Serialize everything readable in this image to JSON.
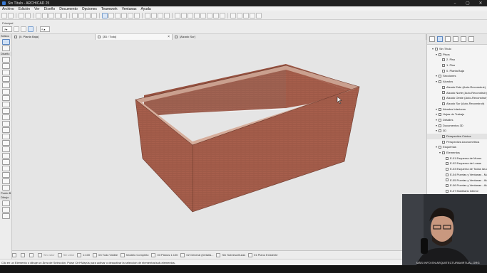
{
  "window": {
    "title": "Sin Título - ARCHICAD 25"
  },
  "menu": [
    "Archivo",
    "Edición",
    "Ver",
    "Diseño",
    "Documento",
    "Opciones",
    "Teamwork",
    "Ventanas",
    "Ayuda"
  ],
  "infobox": {
    "label": "Principal"
  },
  "toolbox": {
    "sections": [
      "Selecc",
      "Diseño",
      "Punto B",
      "Dibujo"
    ]
  },
  "tabs": [
    {
      "label": "[0. Planta Baja]",
      "active": false
    },
    {
      "label": "[3D / Todo]",
      "active": true
    },
    {
      "label": "[Alzado Sur]",
      "active": false
    }
  ],
  "navigator": {
    "items": [
      {
        "label": "Sin Título",
        "depth": 1
      },
      {
        "label": "Pisos",
        "depth": 2
      },
      {
        "label": "2. Piso",
        "depth": 3
      },
      {
        "label": "1. Piso",
        "depth": 3
      },
      {
        "label": "0. Planta Baja",
        "depth": 3
      },
      {
        "label": "Secciones",
        "depth": 2
      },
      {
        "label": "Alzados",
        "depth": 2
      },
      {
        "label": "Alzado Este (Auto-Reconstruir)",
        "depth": 3
      },
      {
        "label": "Alzado Norte (Auto-Reconstruir)",
        "depth": 3
      },
      {
        "label": "Alzado Oeste (Auto-Reconstruir)",
        "depth": 3
      },
      {
        "label": "Alzado Sur (Auto-Reconstruir)",
        "depth": 3
      },
      {
        "label": "Alzados Interiores",
        "depth": 2
      },
      {
        "label": "Hojas de Trabajo",
        "depth": 2
      },
      {
        "label": "Detalles",
        "depth": 2
      },
      {
        "label": "Documentos 3D",
        "depth": 2
      },
      {
        "label": "3D",
        "depth": 2
      },
      {
        "label": "Perspectiva Cónica",
        "depth": 3,
        "selected": true
      },
      {
        "label": "Perspectiva Axonométrica",
        "depth": 3
      },
      {
        "label": "Esquemas",
        "depth": 2
      },
      {
        "label": "Elementos",
        "depth": 3
      },
      {
        "label": "E-01 Esquema de Muros",
        "depth": 4
      },
      {
        "label": "E-02 Esquema de Losas",
        "depth": 4
      },
      {
        "label": "E-03 Esquema de Todas las Aberturas",
        "depth": 4
      },
      {
        "label": "E-04 Puertas y Ventanas - Mapa",
        "depth": 4
      },
      {
        "label": "E-05 Puertas y Ventanas - Alzados",
        "depth": 4
      },
      {
        "label": "E-06 Puertas y Ventanas - Alzados",
        "depth": 4
      },
      {
        "label": "E-07 Mobiliario interior",
        "depth": 4
      }
    ]
  },
  "statusbar": {
    "items": [
      "Sin valor",
      "Sin valor",
      "1:100",
      "03 Todo Visible",
      "Modelo Completo",
      "03 Planos 1:100",
      "02 General (Detalla...",
      "Sin Sobrescrituras",
      "01 Plano Existente"
    ]
  },
  "message": "Clic en un Elemento o dibuje un Área de Selección. Pulse Ctrl+Mayús para activar o desactivar la selección de elementos/sub-elementos.",
  "webcam": {
    "caption": "MÁS INFO EN ARQUITECTURAVIRTUAL.ORG"
  }
}
